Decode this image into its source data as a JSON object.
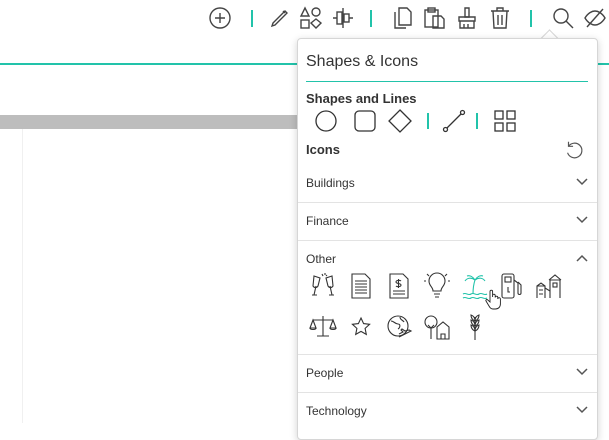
{
  "toolbar": {
    "icons": [
      "add-circle-icon",
      "edit-pencil-icon",
      "shapes-icon",
      "align-icon",
      "copy-icon",
      "paste-icon",
      "format-brush-icon",
      "delete-icon",
      "search-icon",
      "hide-eye-icon"
    ]
  },
  "panel": {
    "title": "Shapes & Icons",
    "shapes_section": "Shapes and Lines",
    "icons_section": "Icons",
    "categories": [
      {
        "label": "Buildings",
        "expanded": false
      },
      {
        "label": "Finance",
        "expanded": false
      },
      {
        "label": "Other",
        "expanded": true
      },
      {
        "label": "People",
        "expanded": false
      },
      {
        "label": "Technology",
        "expanded": false
      }
    ],
    "other_icons": [
      "champagne-glasses-icon",
      "document-lines-icon",
      "invoice-dollar-icon",
      "lightbulb-icon",
      "palm-tree-icon",
      "fuel-pump-icon",
      "playground-icon",
      "scales-icon",
      "star-icon",
      "globe-plane-icon",
      "trees-house-icon",
      "wheat-icon"
    ]
  },
  "colors": {
    "accent": "#22c3aa",
    "band": "#bdbdbd"
  }
}
